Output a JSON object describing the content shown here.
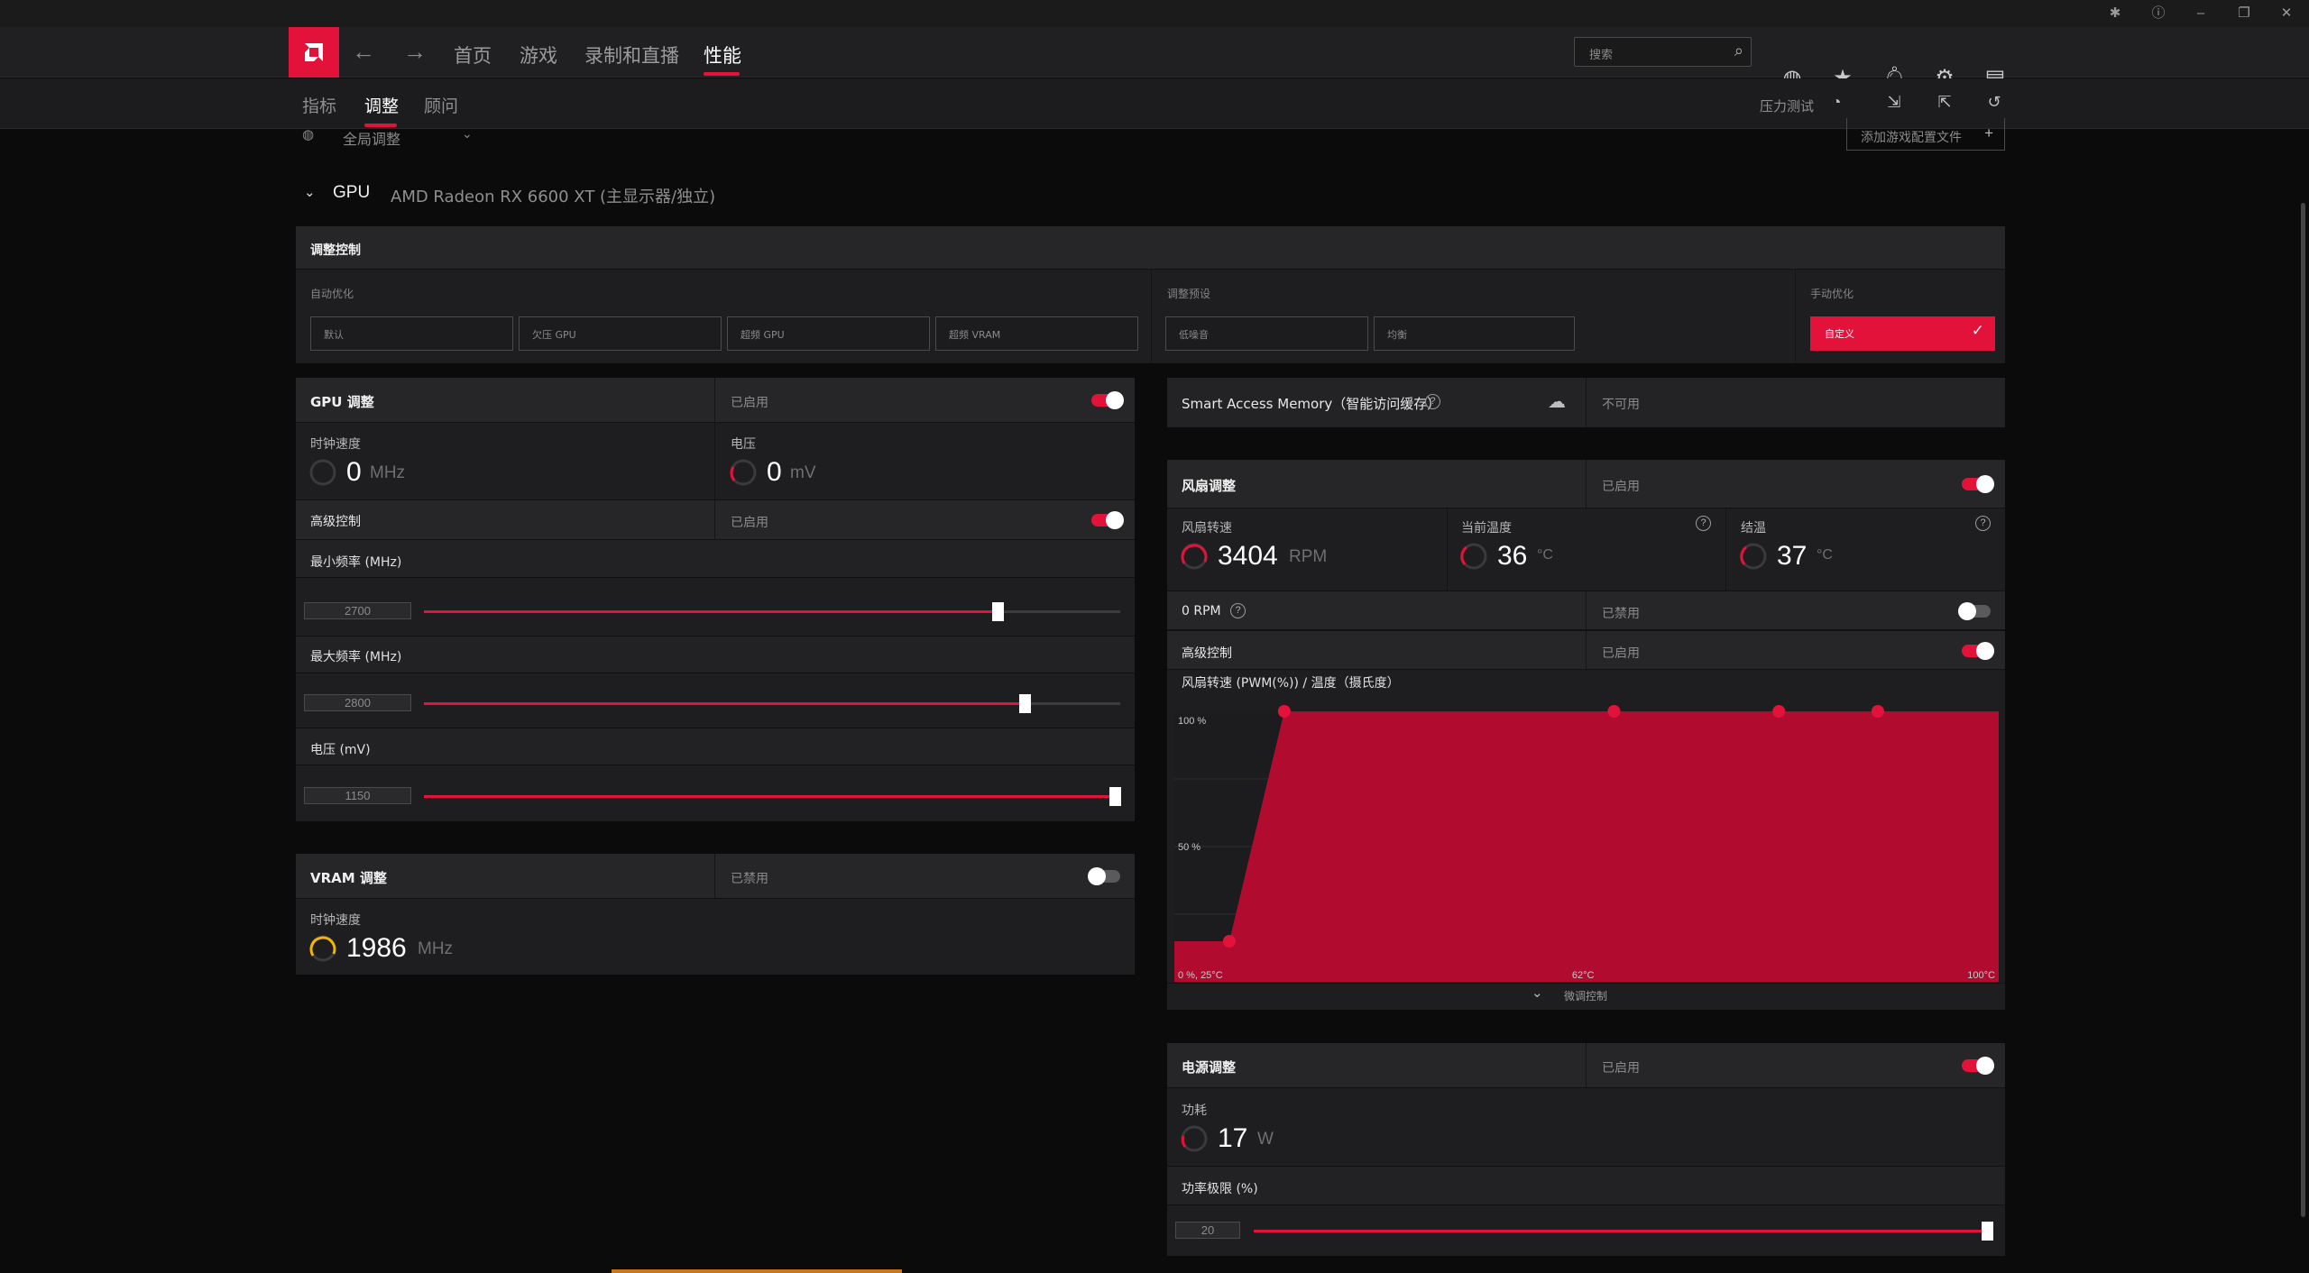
{
  "titlebar": {
    "icons": [
      "bug-icon",
      "help-icon",
      "minimize-icon",
      "restore-icon",
      "close-icon"
    ]
  },
  "nav": {
    "items": [
      "首页",
      "游戏",
      "录制和直播",
      "性能"
    ],
    "active": "性能",
    "search_placeholder": "搜索"
  },
  "subnav": {
    "items": [
      "指标",
      "调整",
      "顾问"
    ],
    "active": "调整",
    "stress_test_label": "压力测试"
  },
  "profile": {
    "global_label": "全局调整",
    "add_profile_label": "添加游戏配置文件"
  },
  "gpu": {
    "label": "GPU",
    "name": "AMD Radeon RX 6600 XT (主显示器/独立)"
  },
  "tuning_control": {
    "title": "调整控制",
    "auto_label": "自动优化",
    "auto_options": [
      "默认",
      "欠压 GPU",
      "超频 GPU",
      "超频 VRAM"
    ],
    "preset_label": "调整预设",
    "preset_options": [
      "低噪音",
      "均衡"
    ],
    "manual_label": "手动优化",
    "manual_value": "自定义"
  },
  "gpu_tuning": {
    "title": "GPU 调整",
    "status": "已启用",
    "enabled": true,
    "clock_label": "时钟速度",
    "clock_value": "0",
    "clock_unit": "MHz",
    "voltage_label": "电压",
    "voltage_value": "0",
    "voltage_unit": "mV",
    "advanced_label": "高级控制",
    "advanced_status": "已启用",
    "advanced_enabled": true,
    "min_freq_label": "最小频率 (MHz)",
    "min_freq_value": "2700",
    "min_freq_fraction": 0.82,
    "max_freq_label": "最大频率 (MHz)",
    "max_freq_value": "2800",
    "max_freq_fraction": 0.86,
    "voltage_slider_label": "电压 (mV)",
    "voltage_slider_value": "1150",
    "voltage_slider_fraction": 1.0
  },
  "vram_tuning": {
    "title": "VRAM 调整",
    "status": "已禁用",
    "enabled": false,
    "clock_label": "时钟速度",
    "clock_value": "1986",
    "clock_unit": "MHz"
  },
  "sam": {
    "label": "Smart Access Memory（智能访问缓存）",
    "status": "不可用"
  },
  "fan_tuning": {
    "title": "风扇调整",
    "status": "已启用",
    "enabled": true,
    "fan_speed_label": "风扇转速",
    "fan_speed_value": "3404",
    "fan_speed_unit": "RPM",
    "current_temp_label": "当前温度",
    "current_temp_value": "36",
    "current_temp_unit": "°C",
    "junction_label": "结温",
    "junction_value": "37",
    "junction_unit": "°C",
    "zero_rpm_label": "0 RPM",
    "zero_rpm_status": "已禁用",
    "zero_rpm_enabled": false,
    "advanced_label": "高级控制",
    "advanced_status": "已启用",
    "advanced_enabled": true,
    "curve_title": "风扇转速 (PWM(%)) / 温度（摄氏度）",
    "fine_tune_label": "微调控制"
  },
  "chart_data": {
    "type": "area",
    "title": "风扇转速 (PWM(%)) / 温度（摄氏度）",
    "x_unit": "°C",
    "y_unit": "%",
    "xlim": [
      25,
      100
    ],
    "ylim": [
      0,
      100
    ],
    "y_tick_labels": [
      "100 %",
      "50 %"
    ],
    "x_tick_labels": [
      "0 %, 25°C",
      "62°C",
      "100°C"
    ],
    "points": [
      {
        "x": 30,
        "y": 15
      },
      {
        "x": 35,
        "y": 100
      },
      {
        "x": 65,
        "y": 100
      },
      {
        "x": 80,
        "y": 100
      },
      {
        "x": 89,
        "y": 100
      }
    ],
    "color": "#b20b30",
    "point_color": "#e3123a"
  },
  "power_tuning": {
    "title": "电源调整",
    "status": "已启用",
    "enabled": true,
    "power_label": "功耗",
    "power_value": "17",
    "power_unit": "W",
    "limit_label": "功率极限 (%)",
    "limit_value": "20",
    "limit_fraction": 1.0
  },
  "colors": {
    "accent": "#e3123a",
    "panel": "#1e1e20",
    "header": "#262628",
    "background": "#0b0b0c"
  }
}
